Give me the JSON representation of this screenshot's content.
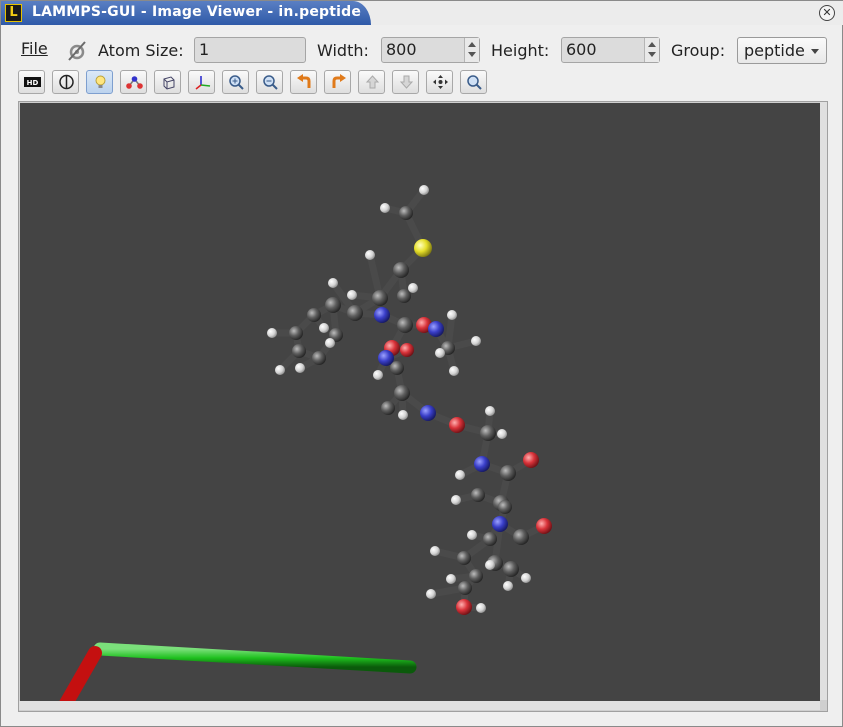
{
  "window": {
    "title": "LAMMPS-GUI - Image Viewer - in.peptide",
    "app_icon_letter": "L"
  },
  "menu": {
    "file_label": "File"
  },
  "controls": {
    "atom_size_label": "Atom Size:",
    "atom_size_value": "1",
    "width_label": "Width:",
    "width_value": "800",
    "height_label": "Height:",
    "height_value": "600",
    "group_label": "Group:",
    "group_value": "peptide"
  },
  "toolbar": {
    "buttons": [
      {
        "icon": "hd-icon",
        "active": false
      },
      {
        "icon": "vdw-style-icon",
        "active": false
      },
      {
        "icon": "lightbulb-icon",
        "active": true
      },
      {
        "icon": "bonds-icon",
        "active": false
      },
      {
        "icon": "box-icon",
        "active": false
      },
      {
        "icon": "axes-icon",
        "active": false
      },
      {
        "icon": "zoom-in-icon",
        "active": false
      },
      {
        "icon": "zoom-out-icon",
        "active": false
      },
      {
        "icon": "rotate-left-icon",
        "active": false
      },
      {
        "icon": "rotate-right-icon",
        "active": false
      },
      {
        "icon": "rotate-up-icon",
        "active": false
      },
      {
        "icon": "rotate-down-icon",
        "active": false
      },
      {
        "icon": "recenter-icon",
        "active": false
      },
      {
        "icon": "reset-view-icon",
        "active": false
      }
    ]
  },
  "colors": {
    "viewport_bg": "#444444",
    "carbon": "#5a5a5a",
    "hydrogen": "#e4e4e4",
    "nitrogen": "#3a3fc9",
    "oxygen": "#d9333a",
    "sulfur": "#e6df2a",
    "axis_x": "#d01010",
    "axis_y": "#1ec01e",
    "axis_z": "#1010e0"
  }
}
